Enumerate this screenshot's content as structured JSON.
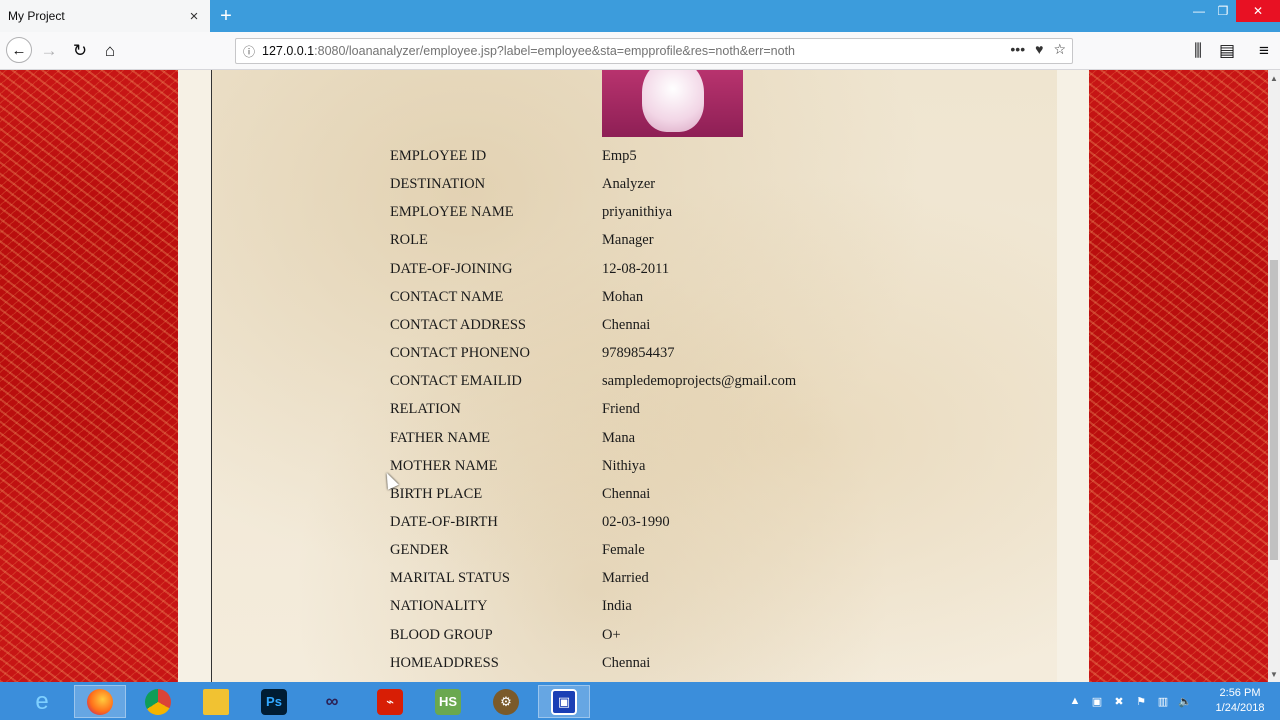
{
  "browser": {
    "tab_title": "My Project",
    "url_host": "127.0.0.1",
    "url_rest": ":8080/loananalyzer/employee.jsp?label=employee&sta=empprofile&res=noth&err=noth"
  },
  "profile": {
    "rows": [
      {
        "label": "EMPLOYEE ID",
        "value": "Emp5"
      },
      {
        "label": "DESTINATION",
        "value": "Analyzer"
      },
      {
        "label": "EMPLOYEE NAME",
        "value": "priyanithiya"
      },
      {
        "label": "ROLE",
        "value": "Manager"
      },
      {
        "label": "DATE-OF-JOINING",
        "value": "12-08-2011"
      },
      {
        "label": "CONTACT NAME",
        "value": "Mohan"
      },
      {
        "label": "CONTACT ADDRESS",
        "value": "Chennai"
      },
      {
        "label": "CONTACT PHONENO",
        "value": "9789854437"
      },
      {
        "label": "CONTACT EMAILID",
        "value": "sampledemoprojects@gmail.com"
      },
      {
        "label": "RELATION",
        "value": "Friend"
      },
      {
        "label": "FATHER NAME",
        "value": "Mana"
      },
      {
        "label": "MOTHER NAME",
        "value": "Nithiya"
      },
      {
        "label": "BIRTH PLACE",
        "value": "Chennai"
      },
      {
        "label": "DATE-OF-BIRTH",
        "value": "02-03-1990"
      },
      {
        "label": "GENDER",
        "value": "Female"
      },
      {
        "label": "MARITAL STATUS",
        "value": "Married"
      },
      {
        "label": "NATIONALITY",
        "value": "India"
      },
      {
        "label": "BLOOD GROUP",
        "value": "O+"
      },
      {
        "label": "HOMEADDRESS",
        "value": "Chennai"
      }
    ]
  },
  "taskbar": {
    "ps_label": "Ps",
    "hs_label": "HS",
    "clock_time": "2:56 PM",
    "clock_date": "1/24/2018"
  },
  "colors": {
    "side_red": "#c71515",
    "taskbar": "#3b8edb",
    "tabstrip": "#3c9cdc"
  }
}
